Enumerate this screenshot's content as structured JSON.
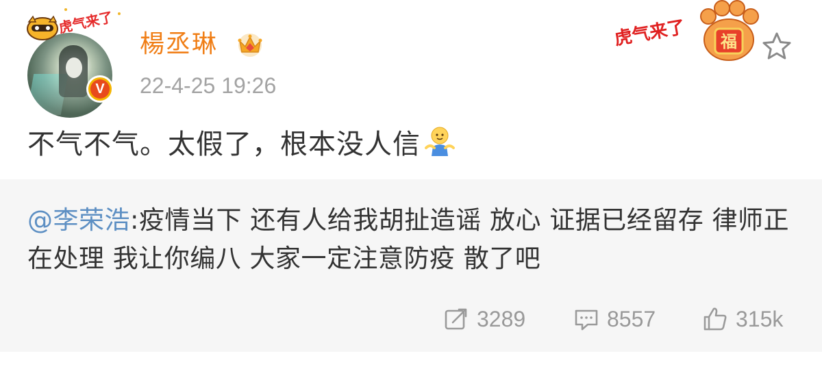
{
  "post": {
    "avatar_frame_text": "虎气来了",
    "username": "楊丞琳",
    "timestamp": "22-4-25 19:26",
    "content": "不气不气。太假了，根本没人信",
    "deco_text": "虎气来了",
    "deco_badge": "福"
  },
  "quote": {
    "mention": "@李荣浩",
    "text": ":疫情当下 还有人给我胡扯造谣 放心 证据已经留存 律师正在处理 我让你编八 大家一定注意防疫 散了吧"
  },
  "actions": {
    "repost_count": "3289",
    "comment_count": "8557",
    "like_count": "315k"
  },
  "colors": {
    "username": "#f07e16",
    "mention": "#5d8fc3",
    "muted": "#a3a3a3",
    "quote_bg": "#f6f6f6"
  }
}
